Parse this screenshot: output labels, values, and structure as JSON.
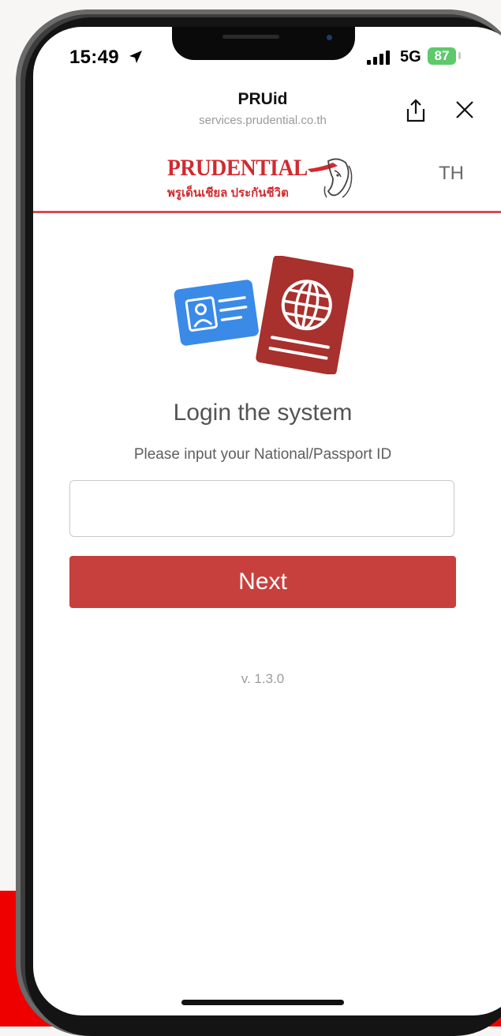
{
  "status_bar": {
    "time": "15:49",
    "network": "5G",
    "battery": "87"
  },
  "browser": {
    "title": "PRUid",
    "url": "services.prudential.co.th",
    "share_icon": "share-icon",
    "close_icon": "close-icon"
  },
  "header": {
    "logo_text": "PRUDENTIAL",
    "logo_subtext": "พรูเด็นเชียล ประกันชีวิต",
    "language": "TH",
    "accent_color": "#d12a2f"
  },
  "main": {
    "illustration_icons": [
      "id-card-icon",
      "passport-icon"
    ],
    "title": "Login the system",
    "instruction": "Please input your National/Passport ID",
    "id_input_value": "",
    "next_label": "Next",
    "version": "v. 1.3.0"
  },
  "colors": {
    "primary_button": "#c7403e",
    "id_card": "#3a8ae8",
    "passport": "#a8302d",
    "background_red": "#ee0000"
  }
}
